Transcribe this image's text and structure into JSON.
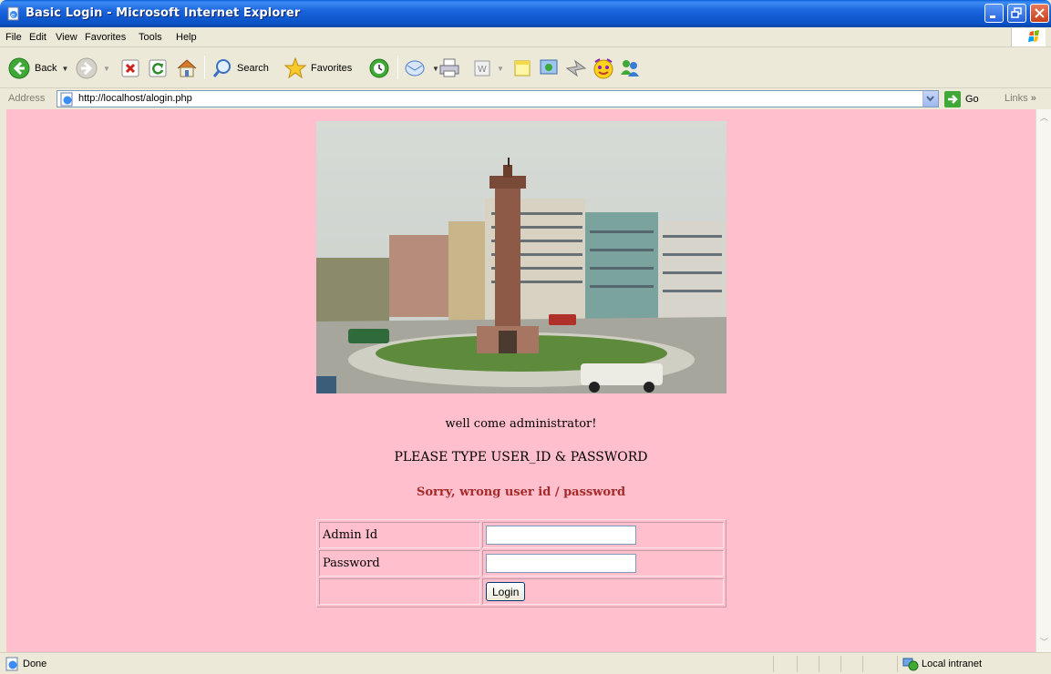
{
  "window": {
    "title": "Basic Login - Microsoft Internet Explorer"
  },
  "menu": {
    "items": [
      {
        "label": "File"
      },
      {
        "label": "Edit"
      },
      {
        "label": "View"
      },
      {
        "label": "Favorites"
      },
      {
        "label": "Tools"
      },
      {
        "label": "Help"
      }
    ]
  },
  "toolbar": {
    "back_label": "Back",
    "search_label": "Search",
    "favorites_label": "Favorites"
  },
  "address": {
    "label": "Address",
    "url": "http://localhost/alogin.php",
    "go_label": "Go",
    "links_label": "Links"
  },
  "page": {
    "welcome": "well come administrator!",
    "instruction": "PLEASE TYPE USER_ID & PASSWORD",
    "error": "Sorry, wrong user id / password",
    "error_color": "#a52a2a",
    "background_color": "#ffbfcc",
    "form": {
      "admin_id_label": "Admin Id",
      "admin_id_value": "",
      "password_label": "Password",
      "password_value": "",
      "login_button": "Login"
    }
  },
  "status": {
    "text": "Done",
    "zone": "Local intranet"
  }
}
